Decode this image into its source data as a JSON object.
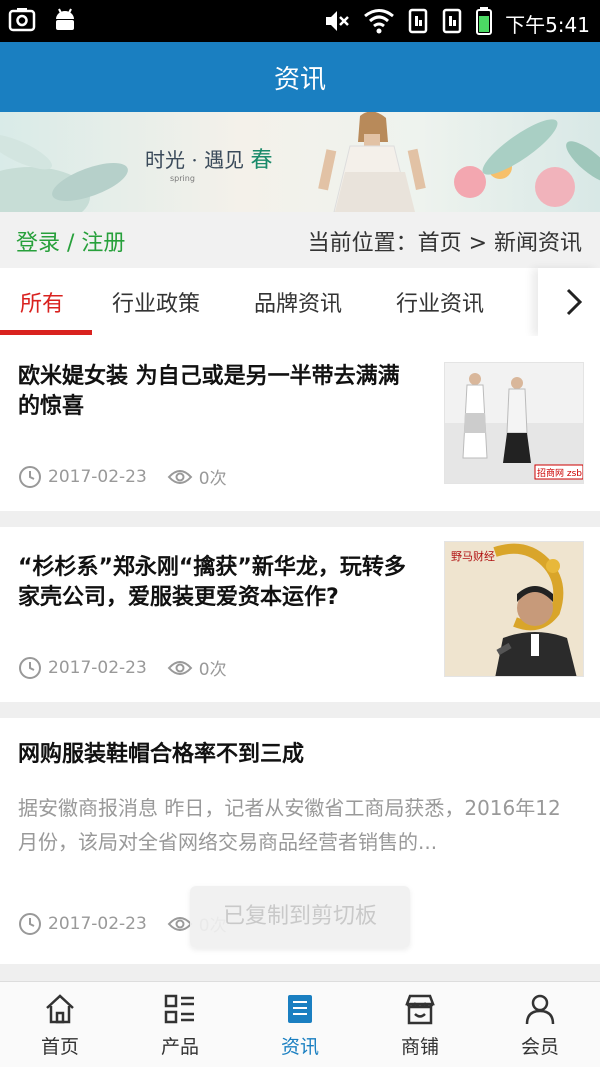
{
  "status_bar": {
    "time": "下午5:41"
  },
  "header": {
    "title": "资讯"
  },
  "banner": {
    "headline_a": "时光 · 遇见",
    "headline_b": "春",
    "caption": "spring"
  },
  "breadcrumb": {
    "login": "登录",
    "separator": " / ",
    "register": "注册",
    "location_label": "当前位置：",
    "path": "首页 > 新闻资讯"
  },
  "tabs": [
    {
      "label": "所有",
      "active": true
    },
    {
      "label": "行业政策"
    },
    {
      "label": "品牌资讯"
    },
    {
      "label": "行业资讯"
    }
  ],
  "news": [
    {
      "title": "欧米媞女装 为自己或是另一半带去满满的惊喜",
      "date": "2017-02-23",
      "views": "0次",
      "thumb_caption": "招商网 zsb.cn"
    },
    {
      "title": "“杉杉系”郑永刚“擒获”新华龙，玩转多家壳公司，爱服装更爱资本运作?",
      "date": "2017-02-23",
      "views": "0次",
      "thumb_caption": "野马财经"
    },
    {
      "title": "网购服装鞋帽合格率不到三成",
      "summary": "据安徽商报消息 昨日，记者从安徽省工商局获悉，2016年12月份，该局对全省网络交易商品经营者销售的...",
      "date": "2017-02-23",
      "views": "0次"
    }
  ],
  "toast": "已复制到剪切板",
  "bottom_nav": [
    {
      "label": "首页",
      "icon": "home-icon"
    },
    {
      "label": "产品",
      "icon": "list-icon"
    },
    {
      "label": "资讯",
      "icon": "news-icon",
      "active": true
    },
    {
      "label": "商铺",
      "icon": "store-icon"
    },
    {
      "label": "会员",
      "icon": "user-icon"
    }
  ],
  "colors": {
    "primary": "#1a7fc1",
    "accent": "#d9221f",
    "login": "#27a03b"
  }
}
